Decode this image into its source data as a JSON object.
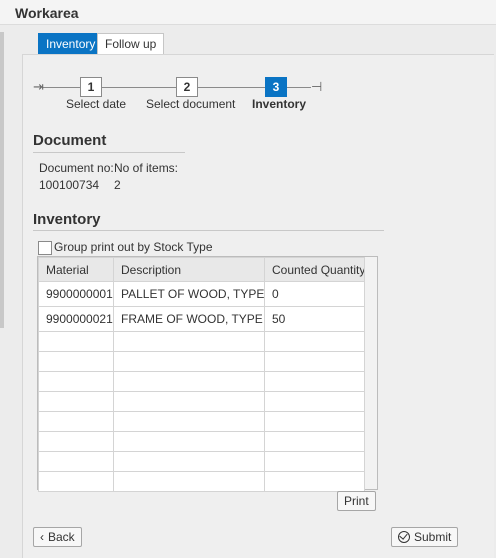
{
  "header": {
    "title": "Workarea"
  },
  "tabs": [
    {
      "label": "Inventory",
      "active": true
    },
    {
      "label": "Follow up",
      "active": false
    }
  ],
  "steps": [
    {
      "number": "1",
      "label": "Select date",
      "current": false
    },
    {
      "number": "2",
      "label": "Select document",
      "current": false
    },
    {
      "number": "3",
      "label": "Inventory",
      "current": true
    }
  ],
  "document": {
    "section_title": "Document",
    "doc_no_label": "Document no:",
    "doc_no_value": "100100734",
    "items_label": "No of items:",
    "items_value": "2"
  },
  "inventory": {
    "section_title": "Inventory",
    "group_print_label": "Group print out by Stock Type",
    "group_print_checked": false,
    "columns": [
      "Material",
      "Description",
      "Counted Quantity"
    ],
    "rows": [
      {
        "material": "9900000001",
        "description": "PALLET OF WOOD, TYPE L",
        "quantity": "0"
      },
      {
        "material": "9900000021",
        "description": "FRAME OF WOOD, TYPE L",
        "quantity": "50"
      }
    ],
    "empty_rows": 8
  },
  "buttons": {
    "print": "Print",
    "back": "Back",
    "submit": "Submit"
  },
  "colors": {
    "accent": "#0a74c4",
    "background": "#ececec"
  }
}
